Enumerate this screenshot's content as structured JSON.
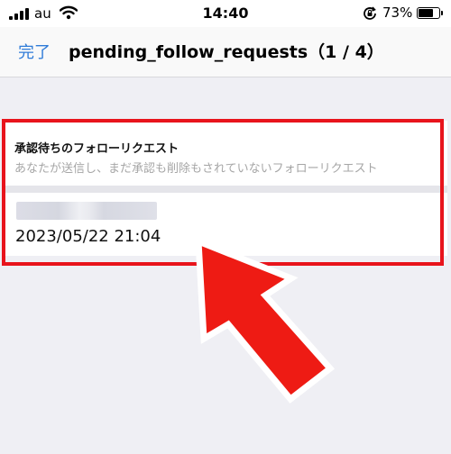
{
  "status_bar": {
    "carrier": "au",
    "time": "14:40",
    "battery_percent": "73%",
    "battery_level": 0.73
  },
  "nav": {
    "done_label": "完了",
    "title": "pending_follow_requests（1 / 4）"
  },
  "section": {
    "title": "承認待ちのフォローリクエスト",
    "subtitle": "あなたが送信し、まだ承認も削除もされていないフォローリクエスト"
  },
  "request": {
    "date": "2023/05/22 21:04"
  },
  "colors": {
    "accent": "#2f7bd8",
    "highlight": "#e8141c"
  }
}
